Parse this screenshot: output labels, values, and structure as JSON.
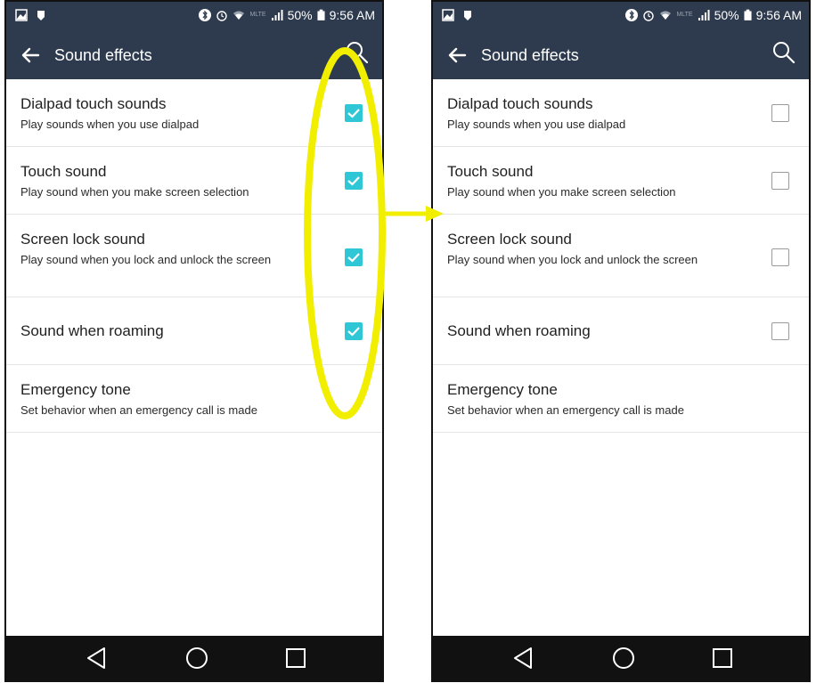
{
  "status": {
    "battery": "50%",
    "time": "9:56 AM",
    "network": "MLTE"
  },
  "screens": [
    {
      "title": "Sound effects",
      "items": [
        {
          "title": "Dialpad touch sounds",
          "summary": "Play sounds when you use dialpad",
          "checked": true
        },
        {
          "title": "Touch sound",
          "summary": "Play sound when you make screen selection",
          "checked": true
        },
        {
          "title": "Screen lock sound",
          "summary": "Play sound when you lock and unlock the screen",
          "checked": true
        },
        {
          "title": "Sound when roaming",
          "summary": "",
          "checked": true
        },
        {
          "title": "Emergency tone",
          "summary": "Set behavior when an emergency call is made",
          "checked": null
        }
      ]
    },
    {
      "title": "Sound effects",
      "items": [
        {
          "title": "Dialpad touch sounds",
          "summary": "Play sounds when you use dialpad",
          "checked": false
        },
        {
          "title": "Touch sound",
          "summary": "Play sound when you make screen selection",
          "checked": false
        },
        {
          "title": "Screen lock sound",
          "summary": "Play sound when you lock and unlock the screen",
          "checked": false
        },
        {
          "title": "Sound when roaming",
          "summary": "",
          "checked": false
        },
        {
          "title": "Emergency tone",
          "summary": "Set behavior when an emergency call is made",
          "checked": null
        }
      ]
    }
  ],
  "colors": {
    "app_bar": "#2e3b4e",
    "checkbox_on": "#2fc7d6",
    "highlight": "#f2ee00",
    "nav_bar": "#111111"
  },
  "icons": {
    "back": "arrow-left-icon",
    "search": "search-icon",
    "nav_back": "triangle-back-icon",
    "nav_home": "circle-home-icon",
    "nav_recent": "square-recent-icon"
  }
}
